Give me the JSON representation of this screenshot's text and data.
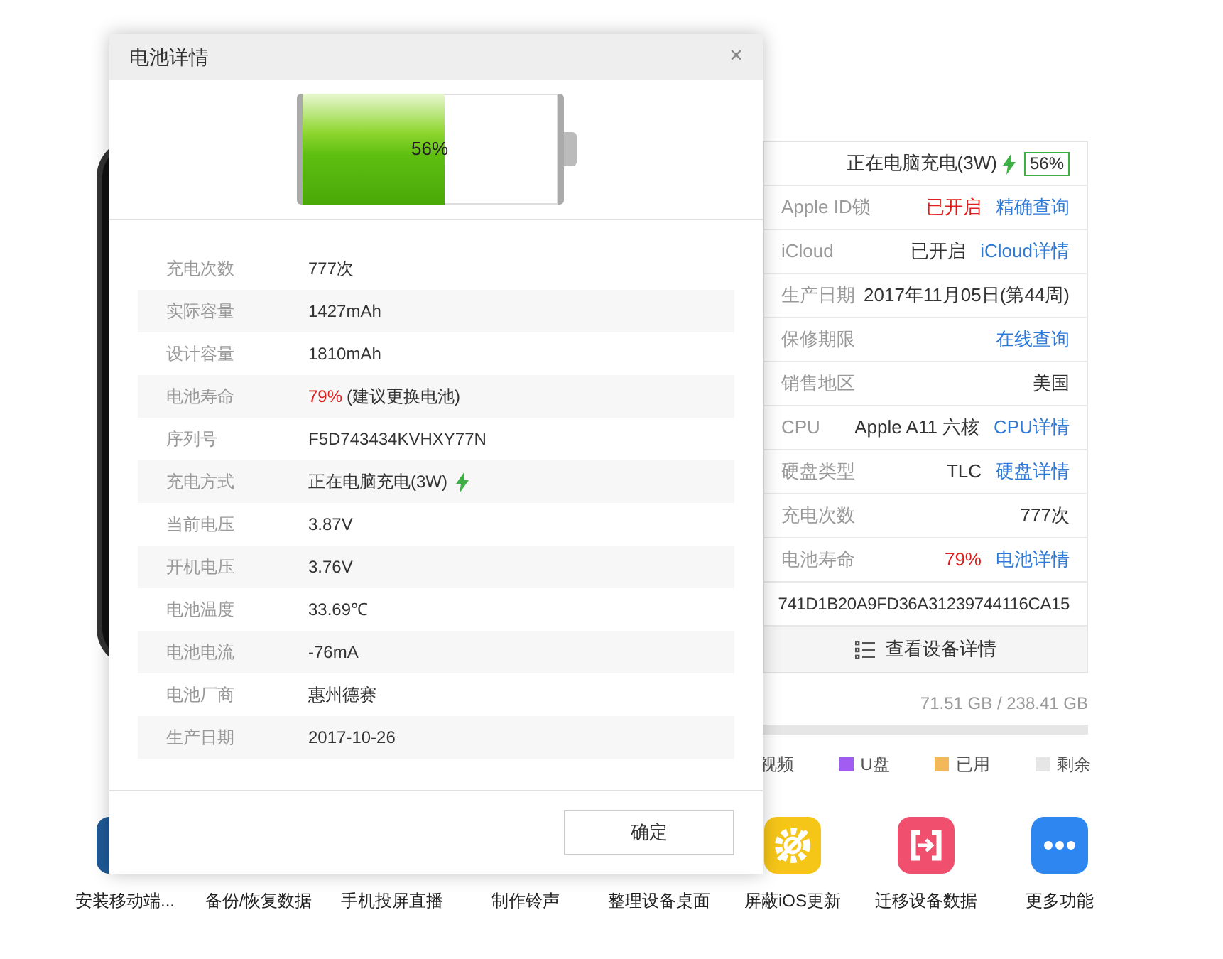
{
  "device_panel": {
    "status": {
      "text": "正在电脑充电(3W)",
      "charging": true,
      "badge": "56%"
    },
    "rows": [
      {
        "label": "Apple ID锁",
        "value": "已开启",
        "warning": true,
        "link": "精确查询"
      },
      {
        "label": "iCloud",
        "value": "已开启",
        "warning": false,
        "link": "iCloud详情"
      },
      {
        "label": "生产日期",
        "value": "2017年11月05日(第44周)",
        "warning": false
      },
      {
        "label": "保修期限",
        "link": "在线查询"
      },
      {
        "label": "销售地区",
        "value": "美国",
        "warning": false
      },
      {
        "label": "CPU",
        "value": "Apple A11 六核",
        "warning": false,
        "link": "CPU详情"
      },
      {
        "label": "硬盘类型",
        "value": "TLC",
        "warning": false,
        "link": "硬盘详情"
      },
      {
        "label": "充电次数",
        "value": "777次",
        "warning": false
      },
      {
        "label": "电池寿命",
        "value": "79%",
        "warning": true,
        "link": "电池详情"
      },
      {
        "value": "741D1B20A9FD36A31239744116CA15",
        "warning": false
      }
    ],
    "details_button": "查看设备详情"
  },
  "storage": {
    "text": "71.51 GB / 238.41 GB",
    "legend": [
      {
        "label": "视频"
      },
      {
        "label": "U盘",
        "color": "#a35cf2"
      },
      {
        "label": "已用",
        "color": "#f2b85a"
      },
      {
        "label": "剩余",
        "color": "#e6e6e6"
      }
    ]
  },
  "tools": [
    {
      "label": "安装移动端..."
    },
    {
      "label": "备份/恢复数据"
    },
    {
      "label": "手机投屏直播"
    },
    {
      "label": "制作铃声"
    },
    {
      "label": "整理设备桌面"
    },
    {
      "label": "屏蔽iOS更新"
    },
    {
      "label": "迁移设备数据"
    },
    {
      "label": "更多功能"
    }
  ],
  "dialog": {
    "title": "电池详情",
    "close": "×",
    "battery": {
      "level": 0.56,
      "text": "56%"
    },
    "rows": [
      {
        "label": "充电次数",
        "value": "777次"
      },
      {
        "label": "实际容量",
        "value": "1427mAh"
      },
      {
        "label": "设计容量",
        "value": "1810mAh"
      },
      {
        "label": "电池寿命",
        "value": "79%",
        "warning": true,
        "note": "(建议更换电池)"
      },
      {
        "label": "序列号",
        "value": "F5D743434KVHXY77N"
      },
      {
        "label": "充电方式",
        "value": "正在电脑充电(3W)",
        "charging": true
      },
      {
        "label": "当前电压",
        "value": "3.87V"
      },
      {
        "label": "开机电压",
        "value": "3.76V"
      },
      {
        "label": "电池温度",
        "value": "33.69℃"
      },
      {
        "label": "电池电流",
        "value": "-76mA"
      },
      {
        "label": "电池厂商",
        "value": "惠州德赛"
      },
      {
        "label": "生产日期",
        "value": "2017-10-26"
      }
    ],
    "ok_button": "确定"
  }
}
